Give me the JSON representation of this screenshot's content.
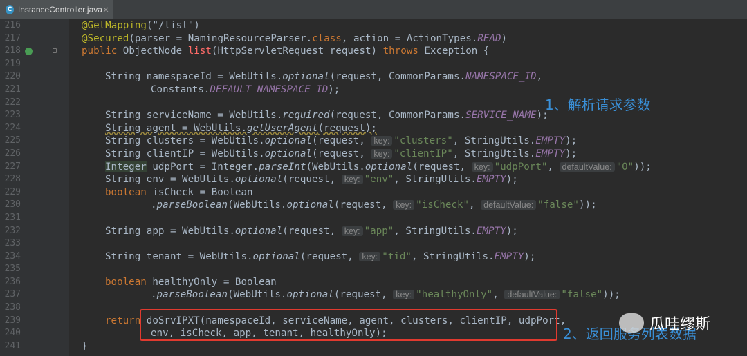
{
  "tab": {
    "icon_letter": "C",
    "title": "InstanceController.java",
    "close": "×"
  },
  "line_numbers": [
    "216",
    "217",
    "218",
    "219",
    "220",
    "221",
    "222",
    "223",
    "224",
    "225",
    "226",
    "227",
    "228",
    "229",
    "230",
    "231",
    "232",
    "233",
    "234",
    "235",
    "236",
    "237",
    "238",
    "239",
    "240",
    "241"
  ],
  "annotations": {
    "note1": "1、解析请求参数",
    "note2": "2、返回服务列表数据",
    "watermark": "瓜哇缪斯"
  },
  "code": {
    "l216": {
      "ann": "@GetMapping",
      "p": "(\"/list\")"
    },
    "l217": {
      "ann": "@Secured",
      "p1": "(parser = NamingResourceParser.",
      "kw": "class",
      "p2": ", action = ActionTypes.",
      "f": "READ",
      "p3": ")"
    },
    "l218": {
      "kw1": "public",
      "p1": " ObjectNode ",
      "fn": "list",
      "p2": "(HttpServletRequest request) ",
      "kw2": "throws",
      "p3": " Exception {"
    },
    "l220": {
      "t": "String namespaceId = WebUtils.",
      "m": "optional",
      "t2": "(request, CommonParams.",
      "f": "NAMESPACE_ID",
      "t3": ","
    },
    "l221": {
      "t": "Constants.",
      "f": "DEFAULT_NAMESPACE_ID",
      "t2": ");"
    },
    "l223": {
      "t": "String serviceName = WebUtils.",
      "m": "required",
      "t2": "(request, CommonParams.",
      "f": "SERVICE_NAME",
      "t3": ");"
    },
    "l224": {
      "t": "String agent = WebUtils.",
      "m": "getUserAgent",
      "t2": "(request);"
    },
    "l225": {
      "t": "String clusters = WebUtils.",
      "m": "optional",
      "t2": "(request, ",
      "h": "key:",
      "s": "\"clusters\"",
      "t3": ", StringUtils.",
      "f": "EMPTY",
      "t4": ");"
    },
    "l226": {
      "t": "String clientIP = WebUtils.",
      "m": "optional",
      "t2": "(request, ",
      "h": "key:",
      "s": "\"clientIP\"",
      "t3": ", StringUtils.",
      "f": "EMPTY",
      "t4": ");"
    },
    "l227": {
      "hl": "Integer",
      "t": " udpPort = Integer.",
      "m": "parseInt",
      "t2": "(WebUtils.",
      "m2": "optional",
      "t3": "(request, ",
      "h": "key:",
      "s": "\"udpPort\"",
      "t4": ", ",
      "h2": "defaultValue:",
      "s2": "\"0\"",
      "t5": "));"
    },
    "l228": {
      "t": "String env = WebUtils.",
      "m": "optional",
      "t2": "(request, ",
      "h": "key:",
      "s": "\"env\"",
      "t3": ", StringUtils.",
      "f": "EMPTY",
      "t4": ");"
    },
    "l229": {
      "kw": "boolean",
      "t": " isCheck = Boolean"
    },
    "l230": {
      "t": ".",
      "m": "parseBoolean",
      "t2": "(WebUtils.",
      "m2": "optional",
      "t3": "(request, ",
      "h": "key:",
      "s": "\"isCheck\"",
      "t4": ", ",
      "h2": "defaultValue:",
      "s2": "\"false\"",
      "t5": "));"
    },
    "l232": {
      "t": "String app = WebUtils.",
      "m": "optional",
      "t2": "(request, ",
      "h": "key:",
      "s": "\"app\"",
      "t3": ", StringUtils.",
      "f": "EMPTY",
      "t4": ");"
    },
    "l234": {
      "t": "String tenant = WebUtils.",
      "m": "optional",
      "t2": "(request, ",
      "h": "key:",
      "s": "\"tid\"",
      "t3": ", StringUtils.",
      "f": "EMPTY",
      "t4": ");"
    },
    "l236": {
      "kw": "boolean",
      "t": " healthyOnly = Boolean"
    },
    "l237": {
      "t": ".",
      "m": "parseBoolean",
      "t2": "(WebUtils.",
      "m2": "optional",
      "t3": "(request, ",
      "h": "key:",
      "s": "\"healthyOnly\"",
      "t4": ", ",
      "h2": "defaultValue:",
      "s2": "\"false\"",
      "t5": "));"
    },
    "l239": {
      "kw": "return",
      "t": " doSrvIPXT(namespaceId, serviceName, agent, clusters, clientIP, udpPort,"
    },
    "l240": {
      "t": "env, isCheck, app, tenant, healthyOnly);"
    },
    "l241": {
      "t": "}"
    }
  }
}
